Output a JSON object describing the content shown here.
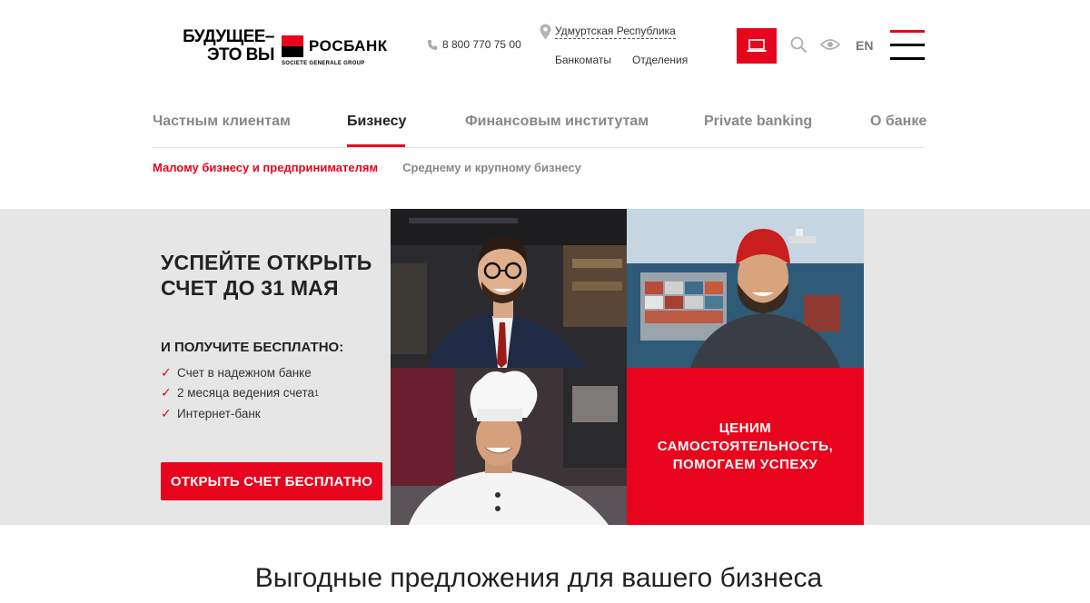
{
  "header": {
    "logo": {
      "slogan_line1": "БУДУЩЕЕ–",
      "slogan_line2": "ЭТО ВЫ",
      "bank_name": "РОСБАНК",
      "group": "SOCIETE GENERALE GROUP"
    },
    "phone": "8 800 770 75 00",
    "region": "Удмуртская Республика",
    "links": [
      "Банкоматы",
      "Отделения"
    ],
    "language": "EN"
  },
  "nav": {
    "items": [
      "Частным клиентам",
      "Бизнесу",
      "Финансовым институтам",
      "Private banking",
      "О банке"
    ],
    "active": "Бизнесу"
  },
  "subnav": {
    "items": [
      "Малому бизнесу и предпринимателям",
      "Среднему и крупному бизнесу"
    ]
  },
  "banner": {
    "title_line1": "УСПЕЙТЕ ОТКРЫТЬ",
    "title_line2": "СЧЕТ ДО 31 МАЯ",
    "subtitle": "И ПОЛУЧИТЕ БЕСПЛАТНО:",
    "benefits": [
      "Счет в надежном банке",
      "2 месяца ведения счета",
      "Интернет-банк"
    ],
    "footnote_mark": "1",
    "cta_label": "ОТКРЫТЬ СЧЕТ БЕСПЛАТНО",
    "red_tile_line1": "ЦЕНИМ",
    "red_tile_line2": "САМОСТОЯТЕЛЬНОСТЬ,",
    "red_tile_line3": "ПОМОГАЕМ УСПЕХУ"
  },
  "section": {
    "title": "Выгодные предложения для вашего бизнеса"
  },
  "colors": {
    "brand_red": "#e9041e",
    "banner_bg": "#e6e6e6"
  }
}
